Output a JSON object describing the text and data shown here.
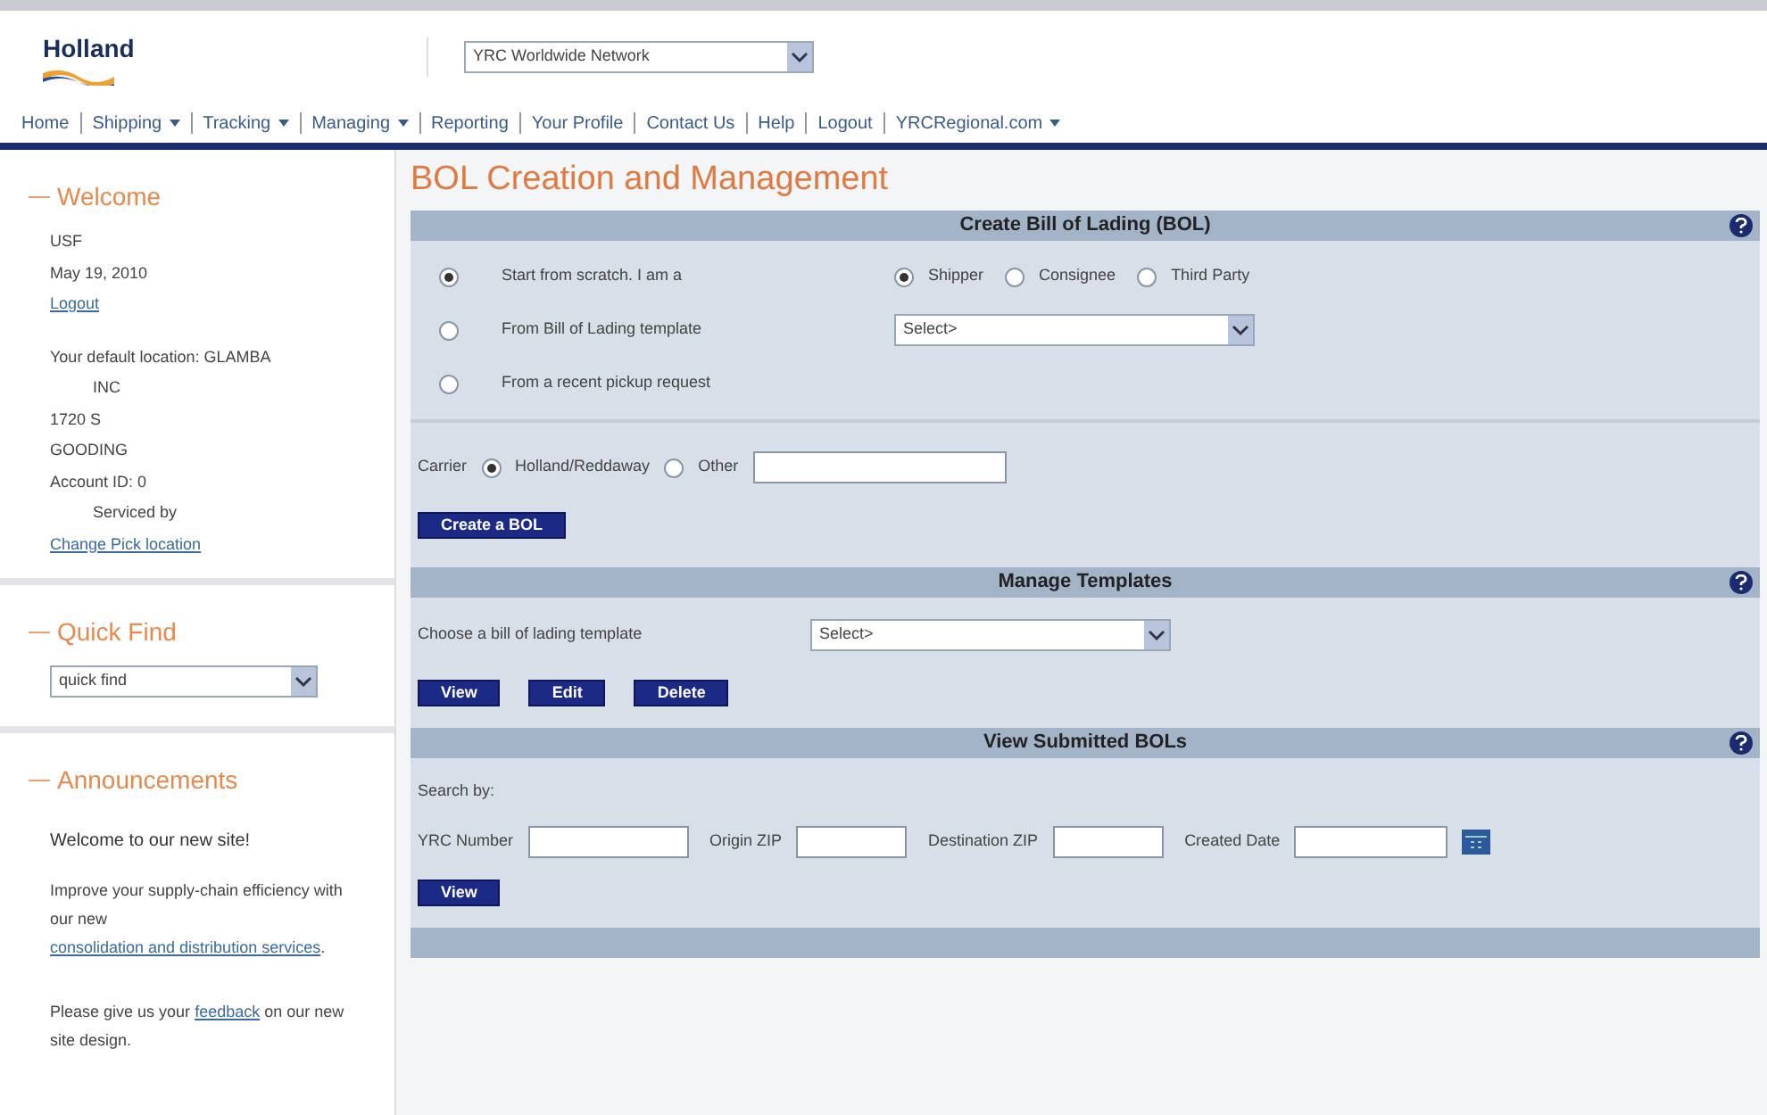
{
  "header": {
    "logo": "Holland",
    "network_select": "YRC Worldwide Network"
  },
  "nav": [
    {
      "label": "Home",
      "has_menu": false
    },
    {
      "label": "Shipping",
      "has_menu": true
    },
    {
      "label": "Tracking",
      "has_menu": true
    },
    {
      "label": "Managing",
      "has_menu": true
    },
    {
      "label": "Reporting",
      "has_menu": false
    },
    {
      "label": "Your Profile",
      "has_menu": false
    },
    {
      "label": "Contact Us",
      "has_menu": false
    },
    {
      "label": "Help",
      "has_menu": false
    },
    {
      "label": "Logout",
      "has_menu": false
    },
    {
      "label": "YRCRegional.com",
      "has_menu": true
    }
  ],
  "sidebar": {
    "welcome": {
      "title": "Welcome",
      "lines": [
        {
          "kind": "text",
          "text": "USF"
        },
        {
          "kind": "text",
          "text": "May 19, 2010"
        },
        {
          "kind": "link",
          "text": "Logout"
        },
        {
          "kind": "gap"
        },
        {
          "kind": "text",
          "text": "Your default location: GLAMBA"
        },
        {
          "kind": "indent",
          "text": "INC"
        },
        {
          "kind": "text",
          "text": "1720 S"
        },
        {
          "kind": "text",
          "text": "GOODING"
        },
        {
          "kind": "text",
          "text": "Account ID: 0"
        },
        {
          "kind": "indent",
          "text": "Serviced by"
        },
        {
          "kind": "link",
          "text": "Change Pick location"
        }
      ]
    },
    "quick_find": {
      "title": "Quick Find",
      "value": "quick find"
    },
    "announcements": {
      "title": "Announcements",
      "headline": "Welcome to our new site!",
      "text_before": "Improve your supply-chain efficiency with our new",
      "link": "consolidation and distribution services",
      "text_after": ".",
      "feedback_before": "Please give us your",
      "feedback_link": "feedback",
      "feedback_after": "on our new site design."
    }
  },
  "page_title": "BOL Creation and Management",
  "create": {
    "title": "Create Bill of Lading (BOL)",
    "options": [
      {
        "label": "Start from scratch. I am a",
        "selected": true
      },
      {
        "label": "From Bill of Lading template",
        "selected": false
      },
      {
        "label": "From a recent pickup request",
        "selected": false
      }
    ],
    "roles": [
      {
        "label": "Shipper",
        "selected": true
      },
      {
        "label": "Consignee",
        "selected": false
      },
      {
        "label": "Third Party",
        "selected": false
      }
    ],
    "template_select": "Select>",
    "carrier_label": "Carrier",
    "carriers": [
      {
        "label": "Holland/Reddaway",
        "selected": true
      },
      {
        "label": "Other",
        "selected": false
      }
    ],
    "button": "Create a BOL"
  },
  "templates": {
    "title": "Manage Templates",
    "label": "Choose a bill of lading template",
    "select": "Select>",
    "buttons": [
      "View",
      "Edit",
      "Delete"
    ]
  },
  "submitted": {
    "title": "View Submitted BOLs",
    "search_label": "Search by:",
    "fields": [
      {
        "label": "YRC Number",
        "kind": "text"
      },
      {
        "label": "Origin ZIP",
        "kind": "text"
      },
      {
        "label": "Destination ZIP",
        "kind": "text"
      },
      {
        "label": "Created Date",
        "kind": "date"
      }
    ],
    "button": "View"
  }
}
